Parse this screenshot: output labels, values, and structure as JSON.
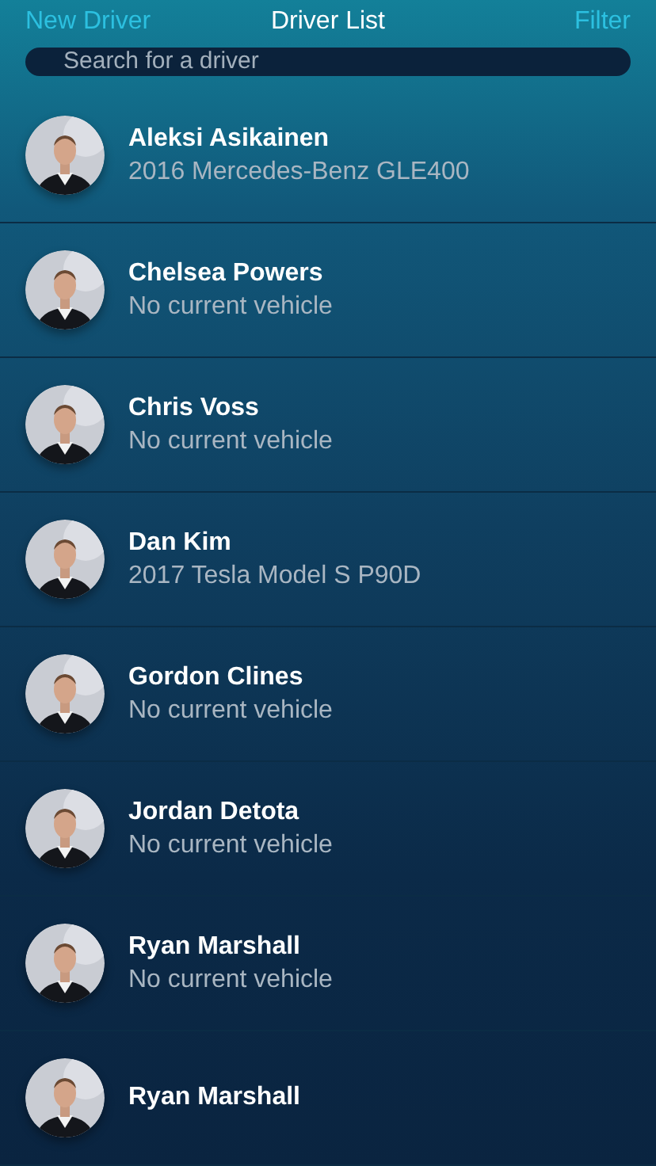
{
  "header": {
    "left_action": "New Driver",
    "title": "Driver List",
    "right_action": "Filter"
  },
  "search": {
    "placeholder": "Search for a driver"
  },
  "drivers": [
    {
      "name": "Aleksi Asikainen",
      "vehicle": "2016 Mercedes-Benz GLE400"
    },
    {
      "name": "Chelsea Powers",
      "vehicle": "No current vehicle"
    },
    {
      "name": "Chris Voss",
      "vehicle": "No current vehicle"
    },
    {
      "name": "Dan Kim",
      "vehicle": "2017 Tesla Model S P90D"
    },
    {
      "name": "Gordon Clines",
      "vehicle": "No current vehicle"
    },
    {
      "name": "Jordan Detota",
      "vehicle": "No current vehicle"
    },
    {
      "name": "Ryan Marshall",
      "vehicle": "No current vehicle"
    },
    {
      "name": "Ryan Marshall"
    }
  ]
}
